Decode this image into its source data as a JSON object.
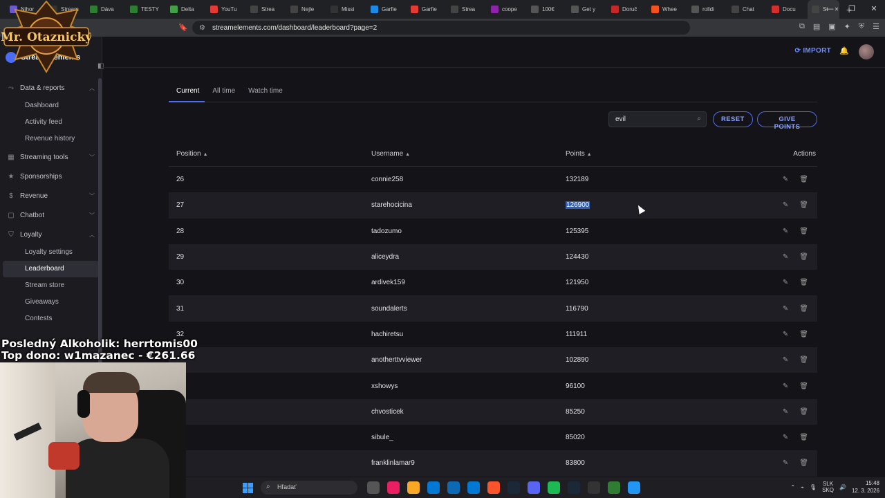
{
  "browser": {
    "tabs": [
      {
        "label": "Nihor",
        "color": "#6a5acd"
      },
      {
        "label": "Stream",
        "color": "#333"
      },
      {
        "label": "Dáva",
        "color": "#2e7d32"
      },
      {
        "label": "TESTY",
        "color": "#2e7d32"
      },
      {
        "label": "Delta",
        "color": "#43a047"
      },
      {
        "label": "YouTu",
        "color": "#e53935"
      },
      {
        "label": "Strea",
        "color": "#444"
      },
      {
        "label": "Nejle",
        "color": "#444"
      },
      {
        "label": "Missi",
        "color": "#333"
      },
      {
        "label": "Garfie",
        "color": "#1e88e5"
      },
      {
        "label": "Garfie",
        "color": "#e53935"
      },
      {
        "label": "Strea",
        "color": "#444"
      },
      {
        "label": "coope",
        "color": "#8e24aa"
      },
      {
        "label": "100€",
        "color": "#555"
      },
      {
        "label": "Get y",
        "color": "#555"
      },
      {
        "label": "Doruč",
        "color": "#c62828"
      },
      {
        "label": "Whee",
        "color": "#f4511e"
      },
      {
        "label": "rolldi",
        "color": "#555"
      },
      {
        "label": "Chat",
        "color": "#444"
      },
      {
        "label": "Docu",
        "color": "#d32f2f"
      },
      {
        "label": "St",
        "color": "#444",
        "active": true
      }
    ],
    "url": "streamelements.com/dashboard/leaderboard?page=2"
  },
  "overlay": {
    "channel_logo": "Mr. Otaznicky",
    "line1": "Posledný Alkoholik: herrtomis00",
    "line2": "Top dono: w1mazanec - €261.66"
  },
  "sidebar": {
    "brand": "StreamElements",
    "groups": [
      {
        "label": "Data & reports",
        "icon": "chart-icon",
        "expanded": true,
        "items": [
          "Dashboard",
          "Activity feed",
          "Revenue history"
        ]
      },
      {
        "label": "Streaming tools",
        "icon": "tools-icon",
        "expanded": false,
        "items": []
      },
      {
        "label": "Sponsorships",
        "icon": "star-icon",
        "expanded": false,
        "items": []
      },
      {
        "label": "Revenue",
        "icon": "dollar-icon",
        "expanded": false,
        "items": []
      },
      {
        "label": "Chatbot",
        "icon": "chat-icon",
        "expanded": false,
        "items": []
      },
      {
        "label": "Loyalty",
        "icon": "loyalty-icon",
        "expanded": true,
        "items": [
          "Loyalty settings",
          "Leaderboard",
          "Stream store",
          "Giveaways",
          "Contests"
        ]
      }
    ],
    "active_item": "Leaderboard"
  },
  "topbar": {
    "import_label": "IMPORT"
  },
  "leaderboard": {
    "tabs": [
      "Current",
      "All time",
      "Watch time"
    ],
    "active_tab": "Current",
    "search_value": "evil",
    "reset_label": "RESET",
    "give_points_label": "GIVE POINTS",
    "columns": {
      "position": "Position",
      "username": "Username",
      "points": "Points",
      "actions": "Actions"
    },
    "rows": [
      {
        "position": "26",
        "username": "connie258",
        "points": "132189"
      },
      {
        "position": "27",
        "username": "starehocicina",
        "points": "126900",
        "selected": true
      },
      {
        "position": "28",
        "username": "tadozumo",
        "points": "125395"
      },
      {
        "position": "29",
        "username": "aliceydra",
        "points": "124430"
      },
      {
        "position": "30",
        "username": "ardivek159",
        "points": "121950"
      },
      {
        "position": "31",
        "username": "soundalerts",
        "points": "116790"
      },
      {
        "position": "32",
        "username": "hachiretsu",
        "points": "111911"
      },
      {
        "position": "",
        "username": "anotherttvviewer",
        "points": "102890"
      },
      {
        "position": "",
        "username": "xshowys",
        "points": "96100"
      },
      {
        "position": "",
        "username": "chvosticek",
        "points": "85250"
      },
      {
        "position": "",
        "username": "sibule_",
        "points": "85020"
      },
      {
        "position": "",
        "username": "franklinlamar9",
        "points": "83800"
      }
    ]
  },
  "taskbar": {
    "search_placeholder": "Hľadať",
    "lang_top": "SLK",
    "lang_bottom": "SKQ",
    "time": "15:48",
    "date": "12. 3. 2026",
    "app_colors": [
      "#555",
      "#e91e63",
      "#f9a825",
      "#0078d4",
      "#0b6ab3",
      "#0078d4",
      "#fb542b",
      "#1b2838",
      "#5865f2",
      "#1db954",
      "#1b2838",
      "#333",
      "#2e7d32",
      "#2196f3"
    ]
  },
  "colors": {
    "accent": "#4b6cf5",
    "background": "#141418",
    "selection": "#2f5fb0"
  }
}
